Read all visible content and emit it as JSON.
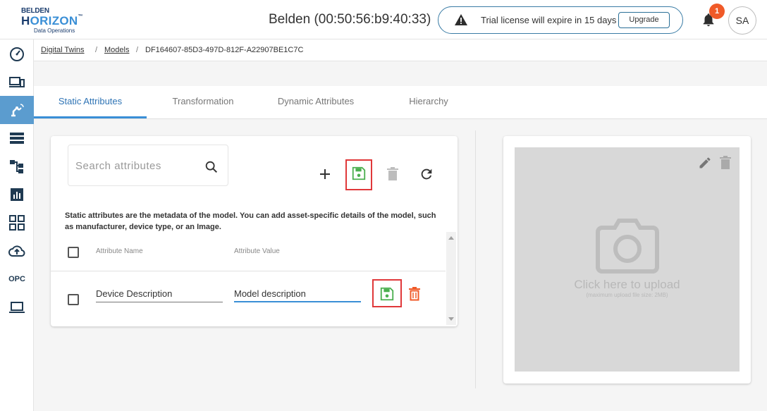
{
  "brand": {
    "line1": "BELDEN",
    "line2a": "H",
    "line2b": "ORIZON",
    "line2c": "™",
    "line3": "Data Operations"
  },
  "header": {
    "device_title": "Belden (00:50:56:b9:40:33)",
    "trial_message": "Trial license will expire in 15 days",
    "upgrade_label": "Upgrade",
    "notification_count": "1",
    "avatar_initials": "SA"
  },
  "sidebar": {
    "items": [
      {
        "icon": "dashboard-gauge-icon"
      },
      {
        "icon": "devices-icon"
      },
      {
        "icon": "digital-twin-robot-icon",
        "active": true
      },
      {
        "icon": "list-icon"
      },
      {
        "icon": "hierarchy-icon"
      },
      {
        "icon": "analytics-icon"
      },
      {
        "icon": "apps-grid-icon"
      },
      {
        "icon": "cloud-upload-icon"
      },
      {
        "label": "OPC"
      },
      {
        "icon": "laptop-icon"
      }
    ],
    "active_color": "#5b9ccf"
  },
  "breadcrumb": {
    "items": [
      "Digital Twins",
      "Models",
      "DF164607-85D3-497D-812F-A22907BE1C7C"
    ],
    "separator": "/"
  },
  "tabs": [
    "Static Attributes",
    "Transformation",
    "Dynamic Attributes",
    "Hierarchy"
  ],
  "active_tab": "Static Attributes",
  "attributes": {
    "search_placeholder": "Search attributes",
    "description": "Static attributes are the metadata of the model. You can add asset-specific details of the model, such as manufacturer, device type, or an Image.",
    "col_name": "Attribute Name",
    "col_value": "Attribute Value",
    "rows": [
      {
        "name": "Device Description",
        "value": "Model description"
      }
    ]
  },
  "image_panel": {
    "upload_text": "Click here to upload",
    "upload_hint": "(maximum upload file size: 2MB)"
  },
  "colors": {
    "accent": "#3a8fd6",
    "save_green": "#4caf50",
    "delete_red": "#f05a28",
    "highlight": "#e0383a"
  }
}
